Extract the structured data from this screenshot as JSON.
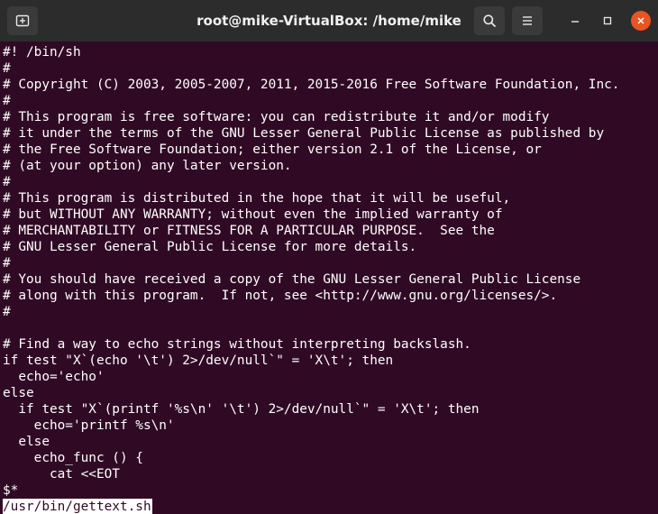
{
  "window": {
    "title": "root@mike-VirtualBox: /home/mike"
  },
  "titlebar": {
    "new_tab_icon": "new-tab-icon",
    "search_icon": "search-icon",
    "menu_icon": "hamburger-menu-icon",
    "minimize_icon": "minimize-icon",
    "maximize_icon": "maximize-icon",
    "close_icon": "close-icon",
    "close_color": "#e95420"
  },
  "terminal": {
    "background": "#300a24",
    "foreground": "#ffffff",
    "lines": [
      "#! /bin/sh",
      "#",
      "# Copyright (C) 2003, 2005-2007, 2011, 2015-2016 Free Software Foundation, Inc.",
      "#",
      "# This program is free software: you can redistribute it and/or modify",
      "# it under the terms of the GNU Lesser General Public License as published by",
      "# the Free Software Foundation; either version 2.1 of the License, or",
      "# (at your option) any later version.",
      "#",
      "# This program is distributed in the hope that it will be useful,",
      "# but WITHOUT ANY WARRANTY; without even the implied warranty of",
      "# MERCHANTABILITY or FITNESS FOR A PARTICULAR PURPOSE.  See the",
      "# GNU Lesser General Public License for more details.",
      "#",
      "# You should have received a copy of the GNU Lesser General Public License",
      "# along with this program.  If not, see <http://www.gnu.org/licenses/>.",
      "#",
      "",
      "# Find a way to echo strings without interpreting backslash.",
      "if test \"X`(echo '\\t') 2>/dev/null`\" = 'X\\t'; then",
      "  echo='echo'",
      "else",
      "  if test \"X`(printf '%s\\n' '\\t') 2>/dev/null`\" = 'X\\t'; then",
      "    echo='printf %s\\n'",
      "  else",
      "    echo_func () {",
      "      cat <<EOT",
      "$*"
    ],
    "status_line": "/usr/bin/gettext.sh"
  }
}
